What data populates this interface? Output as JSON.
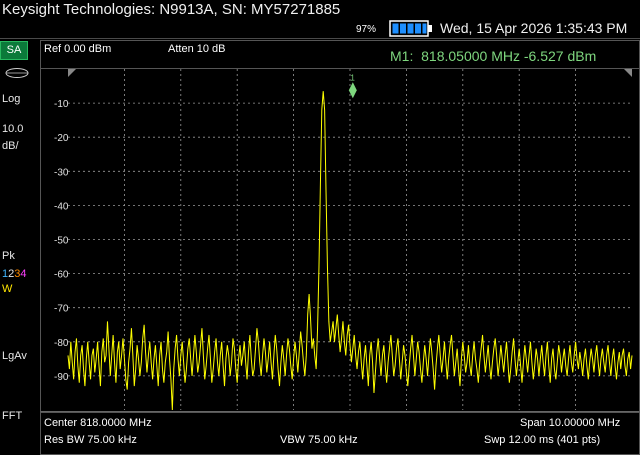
{
  "header": {
    "title": "Keysight Technologies: N9913A, SN: MY57271885",
    "battery_pct": "97%",
    "datetime": "Wed, 15 Apr 2026 1:35:43 PM"
  },
  "sidebar": {
    "mode": "SA",
    "scale_type": "Log",
    "scale_value": "10.0",
    "scale_unit": "dB/",
    "detector": "Pk",
    "traces": [
      "1",
      "2",
      "3",
      "4"
    ],
    "trace_state": "W",
    "averaging": "LgAv",
    "sweep_mode": "FFT"
  },
  "info": {
    "ref_level": "Ref 0.00 dBm",
    "attenuation": "Atten 10 dB",
    "marker_label": "M1:",
    "marker_freq": "818.05000 MHz",
    "marker_amp": "-6.527 dBm",
    "marker_number": "1"
  },
  "footer": {
    "center": "Center 818.0000 MHz",
    "span": "Span 10.00000 MHz",
    "rbw": "Res BW 75.00 kHz",
    "vbw": "VBW 75.00 kHz",
    "sweep": "Swp 12.00 ms (401 pts)"
  },
  "colors": {
    "trace": "#ffff00",
    "marker": "#7ed67e",
    "grid": "#9a9a9a",
    "mode_tab": "#0b7a3a"
  },
  "chart_data": {
    "type": "line",
    "x_unit": "MHz",
    "y_unit": "dBm",
    "xlim": [
      813.0,
      823.0
    ],
    "ylim": [
      -100,
      0
    ],
    "y_ticks": [
      -10,
      -20,
      -30,
      -40,
      -50,
      -60,
      -70,
      -80,
      -90
    ],
    "y_tick_labels": [
      "-10",
      "-20",
      "-30",
      "-40",
      "-50",
      "-60",
      "-70",
      "-80",
      "-90"
    ],
    "grid": true,
    "series": [
      {
        "values": [
          -84,
          -88,
          -80,
          -86,
          -91,
          -83,
          -79,
          -87,
          -92,
          -84,
          -81,
          -88,
          -93,
          -85,
          -80,
          -86,
          -91,
          -84,
          -82,
          -89,
          -85,
          -80,
          -87,
          -93,
          -83,
          -79,
          -86,
          -84,
          -74,
          -82,
          -90,
          -84,
          -78,
          -86,
          -92,
          -83,
          -80,
          -88,
          -84,
          -79,
          -85,
          -91,
          -94,
          -86,
          -82,
          -76,
          -84,
          -93,
          -88,
          -81,
          -85,
          -90,
          -86,
          -79,
          -75,
          -83,
          -89,
          -84,
          -80,
          -86,
          -91,
          -85,
          -81,
          -87,
          -93,
          -84,
          -80,
          -88,
          -92,
          -86,
          -83,
          -77,
          -85,
          -91,
          -100,
          -88,
          -82,
          -78,
          -85,
          -90,
          -84,
          -80,
          -86,
          -92,
          -88,
          -82,
          -79,
          -85,
          -90,
          -84,
          -78,
          -83,
          -89,
          -86,
          -81,
          -76,
          -84,
          -91,
          -87,
          -82,
          -78,
          -85,
          -92,
          -88,
          -83,
          -79,
          -86,
          -90,
          -84,
          -80,
          -87,
          -93,
          -85,
          -81,
          -84,
          -90,
          -86,
          -79,
          -82,
          -88,
          -92,
          -85,
          -81,
          -87,
          -84,
          -80,
          -86,
          -91,
          -83,
          -78,
          -85,
          -90,
          -88,
          -82,
          -76,
          -80,
          -86,
          -90,
          -84,
          -79,
          -83,
          -89,
          -85,
          -80,
          -86,
          -91,
          -84,
          -78,
          -82,
          -88,
          -93,
          -86,
          -81,
          -85,
          -90,
          -84,
          -79,
          -82,
          -87,
          -91,
          -85,
          -80,
          -84,
          -89,
          -83,
          -77,
          -81,
          -86,
          -90,
          -84,
          -72,
          -66,
          -73,
          -82,
          -79,
          -84,
          -88,
          -76,
          -58,
          -34,
          -12,
          -6.5,
          -12,
          -36,
          -58,
          -74,
          -80,
          -77,
          -74,
          -80,
          -76,
          -72,
          -78,
          -83,
          -79,
          -74,
          -80,
          -84,
          -78,
          -75,
          -81,
          -86,
          -82,
          -78,
          -84,
          -88,
          -83,
          -80,
          -86,
          -91,
          -85,
          -81,
          -87,
          -93,
          -84,
          -80,
          -86,
          -95,
          -89,
          -83,
          -79,
          -85,
          -90,
          -84,
          -81,
          -87,
          -92,
          -86,
          -82,
          -78,
          -84,
          -90,
          -87,
          -82,
          -79,
          -85,
          -91,
          -86,
          -81,
          -84,
          -89,
          -93,
          -87,
          -82,
          -78,
          -84,
          -90,
          -85,
          -80,
          -83,
          -88,
          -92,
          -86,
          -81,
          -85,
          -90,
          -84,
          -79,
          -83,
          -88,
          -94,
          -87,
          -82,
          -78,
          -84,
          -89,
          -85,
          -80,
          -86,
          -91,
          -85,
          -81,
          -78,
          -84,
          -90,
          -86,
          -82,
          -88,
          -93,
          -85,
          -80,
          -84,
          -89,
          -86,
          -81,
          -87,
          -90,
          -84,
          -80,
          -85,
          -88,
          -92,
          -86,
          -82,
          -78,
          -84,
          -89,
          -85,
          -81,
          -87,
          -91,
          -86,
          -82,
          -79,
          -84,
          -90,
          -86,
          -81,
          -85,
          -89,
          -84,
          -80,
          -86,
          -92,
          -88,
          -83,
          -79,
          -85,
          -90,
          -86,
          -82,
          -87,
          -92,
          -86,
          -81,
          -85,
          -89,
          -84,
          -80,
          -86,
          -91,
          -87,
          -82,
          -85,
          -90,
          -85,
          -81,
          -86,
          -90,
          -84,
          -80,
          -87,
          -92,
          -85,
          -82,
          -88,
          -91,
          -86,
          -81,
          -84,
          -89,
          -85,
          -82,
          -87,
          -90,
          -85,
          -81,
          -86,
          -89,
          -84,
          -80,
          -85,
          -88,
          -83,
          -86,
          -90,
          -85,
          -82,
          -87,
          -91,
          -86,
          -82,
          -85,
          -89,
          -84,
          -81,
          -86,
          -90,
          -85,
          -82,
          -86,
          -89,
          -84,
          -81,
          -86,
          -90,
          -85,
          -82,
          -87,
          -91,
          -86,
          -83,
          -88,
          -84,
          -82,
          -87,
          -90,
          -85,
          -83,
          -88,
          -84
        ]
      }
    ],
    "marker": {
      "x": 818.05,
      "y": -6.527
    }
  }
}
